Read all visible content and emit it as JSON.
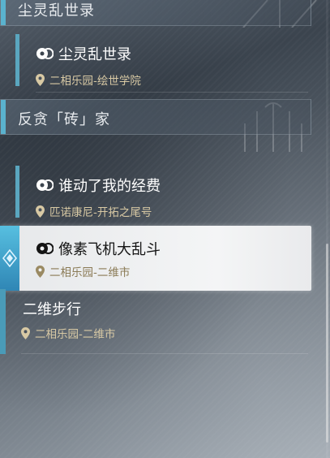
{
  "colors": {
    "accent_blue": "#5ab2ce",
    "location_gold": "#d8c9a4",
    "selected_bg": "#f1f2f3"
  },
  "groups": [
    {
      "label": "尘灵乱世录"
    },
    {
      "label": "反贪「砖」家"
    }
  ],
  "entries": [
    {
      "title": "尘灵乱世录",
      "location": "二相乐园-绘世学院",
      "icon": "quest-icon",
      "selected": false
    },
    {
      "title": "谁动了我的经费",
      "location": "匹诺康尼-开拓之尾号",
      "icon": "quest-icon",
      "selected": false
    },
    {
      "title": "像素飞机大乱斗",
      "location": "二相乐园-二维市",
      "icon": "quest-icon",
      "selected": true
    },
    {
      "title": "二维步行",
      "location": "二相乐园-二维市",
      "icon": "",
      "selected": false
    }
  ]
}
